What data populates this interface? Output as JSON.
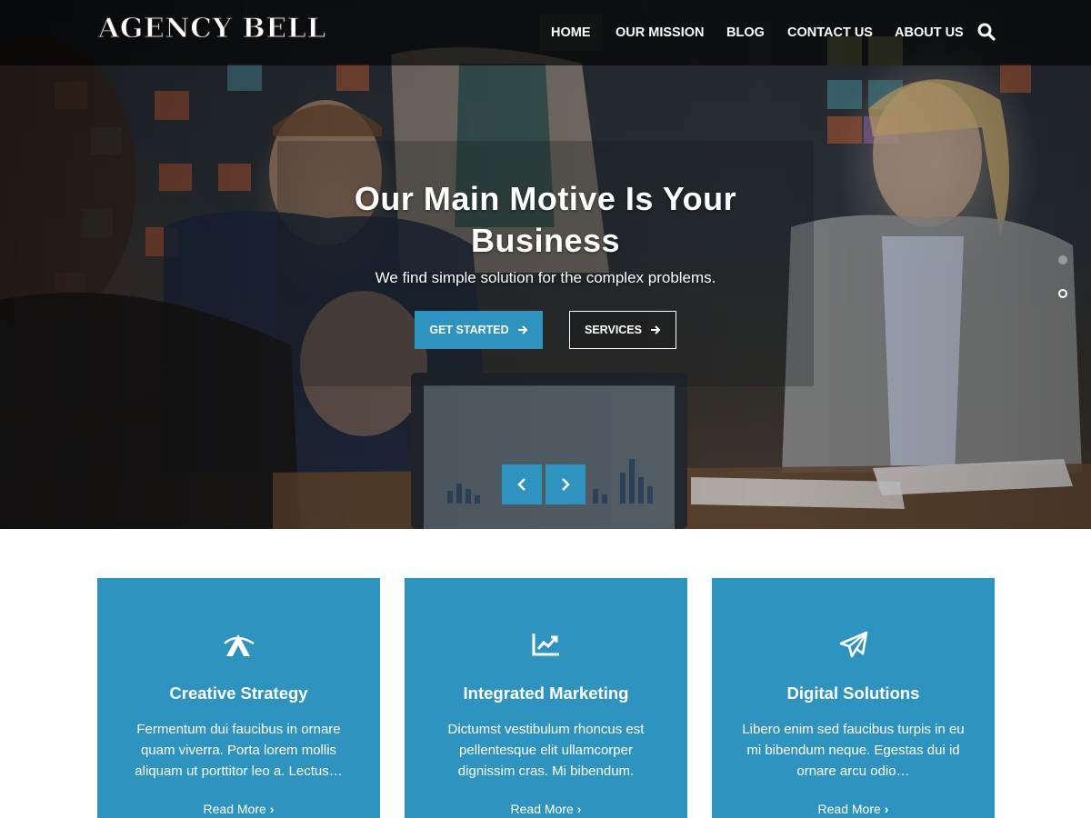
{
  "nav": {
    "logo": "AGENCY BELL",
    "items": [
      {
        "label": "HOME",
        "active": true
      },
      {
        "label": "OUR MISSION",
        "active": false
      },
      {
        "label": "BLOG",
        "active": false
      },
      {
        "label": "CONTACT US",
        "active": false
      },
      {
        "label": "ABOUT US",
        "active": false
      }
    ],
    "search_icon": "search-icon"
  },
  "hero": {
    "title_line1": "Our Main Motive Is Your",
    "title_line2": "Business",
    "subtitle": "We find simple solution for the complex problems.",
    "primary_button": "GET STARTED",
    "secondary_button": "SERVICES",
    "prev_icon": "chevron-left-icon",
    "next_icon": "chevron-right-icon",
    "dots": [
      {
        "active": false
      },
      {
        "active": true
      }
    ]
  },
  "cards": [
    {
      "icon": "adobe-style-logo-icon",
      "title": "Creative Strategy",
      "text": "Fermentum dui faucibus in ornare quam viverra. Porta lorem mollis aliquam ut porttitor leo a. Lectus…",
      "link": "Read More"
    },
    {
      "icon": "chart-line-icon",
      "title": "Integrated Marketing",
      "text": "Dictumst vestibulum rhoncus est pellentesque elit ullamcorper dignissim cras. Mi bibendum.",
      "link": "Read More"
    },
    {
      "icon": "paper-plane-icon",
      "title": "Digital Solutions",
      "text": "Libero enim sed faucibus turpis in eu mi bibendum neque. Egestas dui id ornare arcu odio…",
      "link": "Read More"
    }
  ],
  "colors": {
    "accent": "#2f93bf",
    "nav_bg": "#000000",
    "text_light": "#ffffff"
  }
}
